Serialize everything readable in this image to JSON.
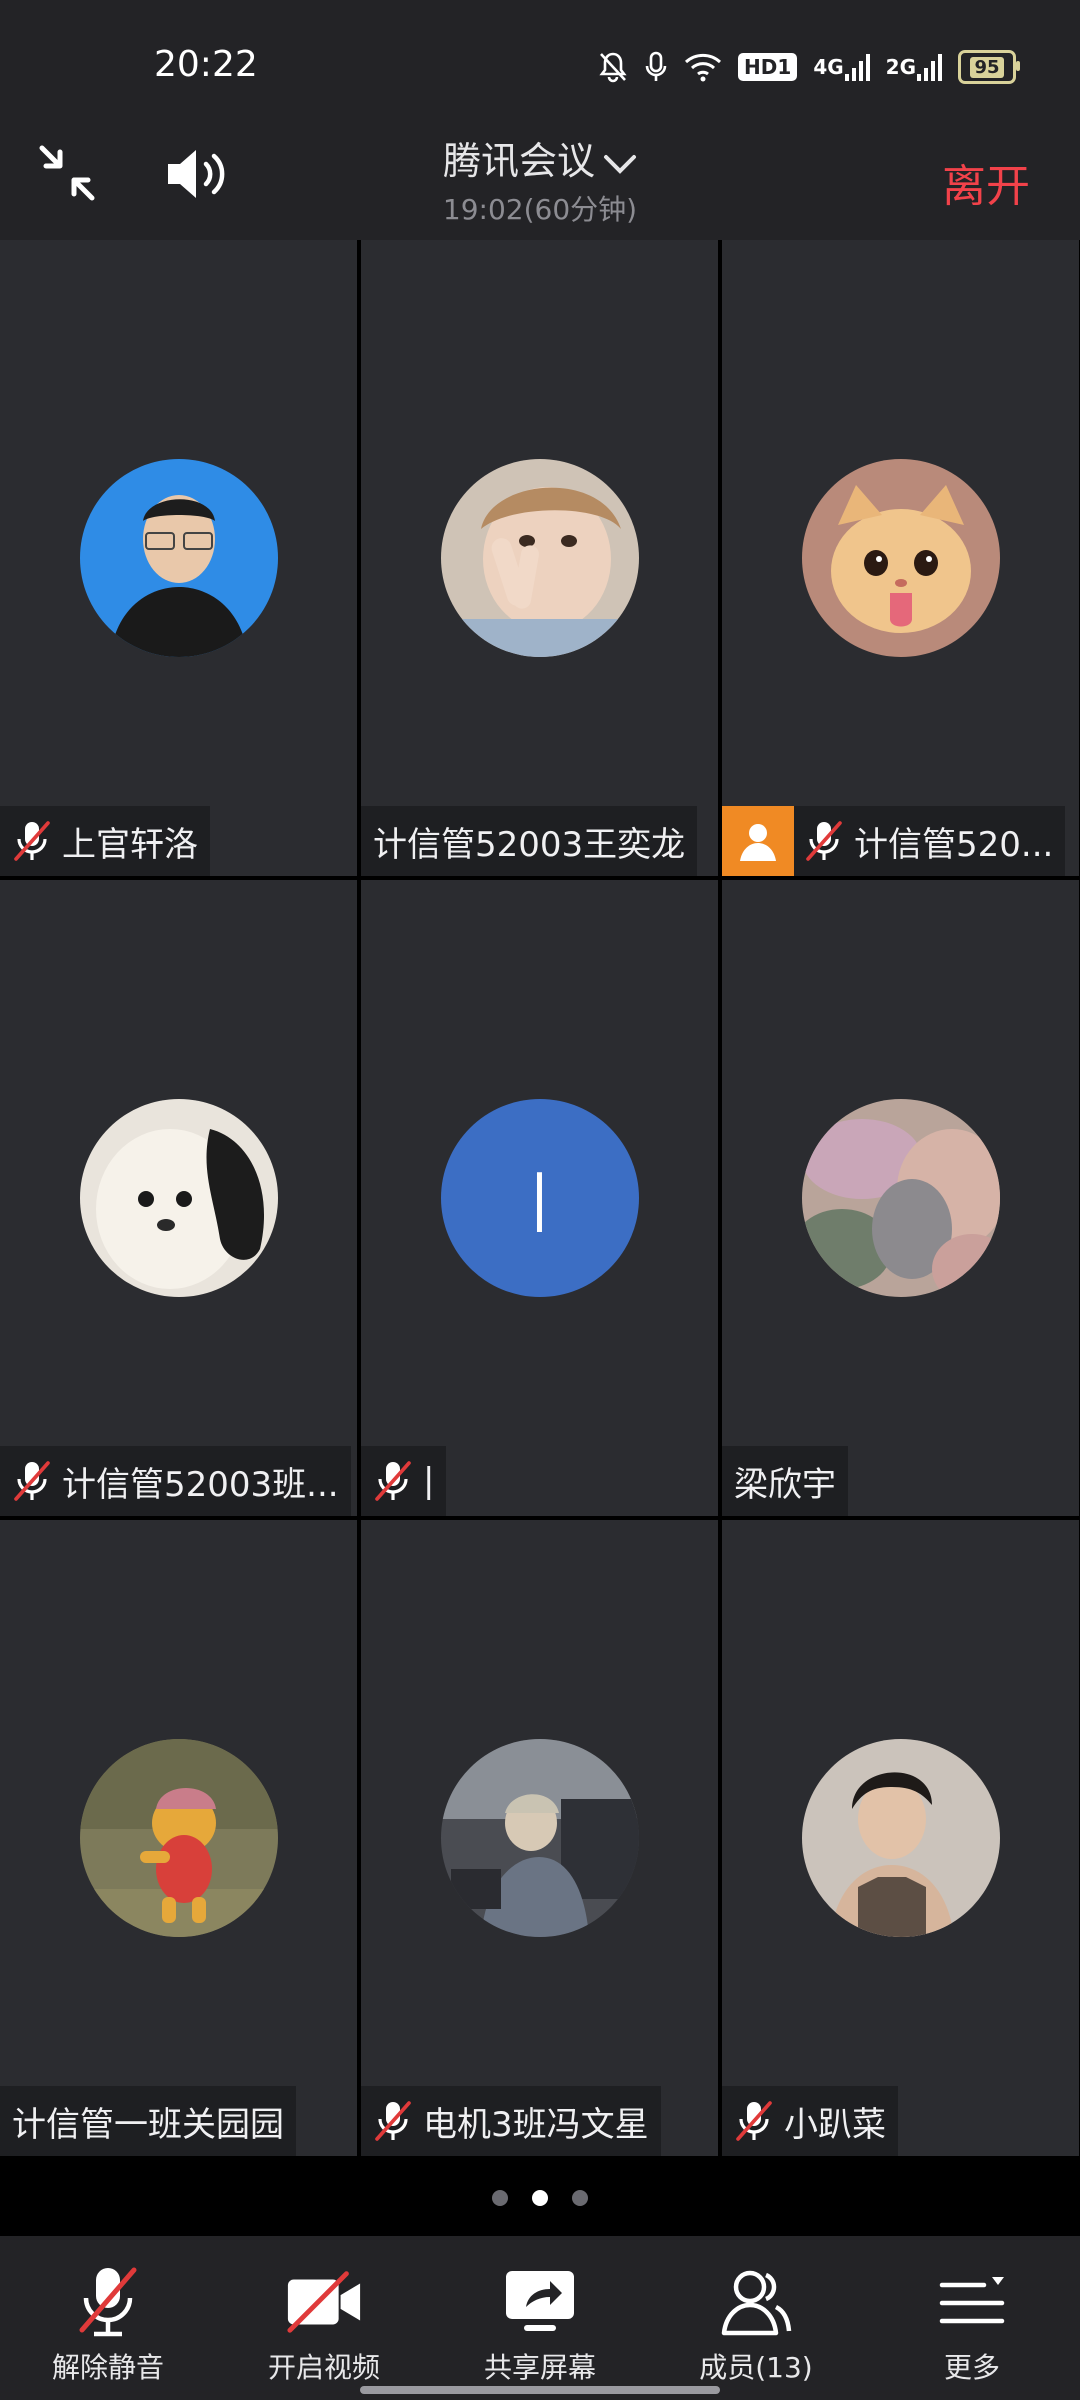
{
  "status_bar": {
    "time": "20:22",
    "hd": "HD1",
    "net1": "4G",
    "net2": "2G",
    "battery": "95"
  },
  "header": {
    "title": "腾讯会议",
    "subtitle": "19:02(60分钟)",
    "leave_label": "离开"
  },
  "participants": [
    {
      "name": "上官轩洛",
      "muted": true
    },
    {
      "name": "计信管52003王奕龙",
      "muted": false
    },
    {
      "name": "计信管520...",
      "muted": true
    },
    {
      "name": "计信管52003班...",
      "muted": true
    },
    {
      "name": "|",
      "muted": true,
      "initial": "|"
    },
    {
      "name": "梁欣宇",
      "muted": false
    },
    {
      "name": "计信管一班关园园",
      "muted": false
    },
    {
      "name": "电机3班冯文星",
      "muted": true
    },
    {
      "name": "小趴菜",
      "muted": true
    }
  ],
  "pager": {
    "pages": 3,
    "current": 2
  },
  "toolbar": {
    "unmute": "解除静音",
    "video": "开启视频",
    "share": "共享屏幕",
    "members": "成员(13)",
    "more": "更多"
  },
  "colors": {
    "accent_leave": "#f2424a",
    "mute_slash": "#e03a3a",
    "tile_bg": "#2b2c30",
    "badge_orange": "#f08a24"
  }
}
